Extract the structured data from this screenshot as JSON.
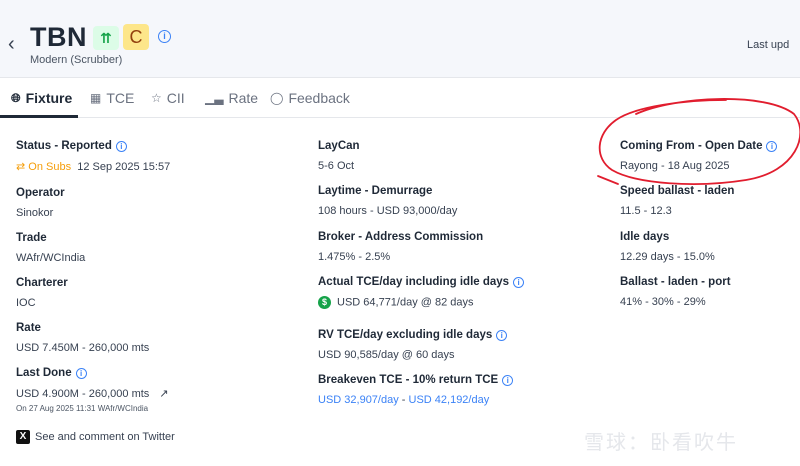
{
  "header": {
    "back_icon": "chevron-left-icon",
    "title": "TBN",
    "grade_badge": "C",
    "subtitle": "Modern (Scrubber)",
    "last_updated": "Last upd"
  },
  "tabs": [
    {
      "label": "Fixture",
      "icon": "globe-icon",
      "active": true
    },
    {
      "label": "TCE",
      "icon": "grid-icon",
      "active": false
    },
    {
      "label": "CII",
      "icon": "star-icon",
      "active": false
    },
    {
      "label": "Rate",
      "icon": "bar-chart-icon",
      "active": false
    },
    {
      "label": "Feedback",
      "icon": "comment-icon",
      "active": false
    }
  ],
  "col1": {
    "status_label": "Status - Reported",
    "status_badge": "On Subs",
    "status_date": "12 Sep 2025 15:57",
    "operator_label": "Operator",
    "operator_value": "Sinokor",
    "trade_label": "Trade",
    "trade_value": "WAfr/WCIndia",
    "charterer_label": "Charterer",
    "charterer_value": "IOC",
    "rate_label": "Rate",
    "rate_value": "USD 7.450M - 260,000 mts",
    "last_done_label": "Last Done",
    "last_done_value": "USD 4.900M - 260,000 mts",
    "last_done_note": "On 27 Aug 2025 11:31 WAfr/WCIndia"
  },
  "col2": {
    "laycan_label": "LayCan",
    "laycan_value": "5-6 Oct",
    "laytime_label": "Laytime - Demurrage",
    "laytime_value": "108 hours - USD 93,000/day",
    "broker_label": "Broker - Address Commission",
    "broker_value": "1.475% - 2.5%",
    "actual_tce_label": "Actual TCE/day including idle days",
    "actual_tce_value": "USD 64,771/day @ 82 days",
    "rv_tce_label": "RV TCE/day excluding idle days",
    "rv_tce_value": "USD 90,585/day @ 60 days",
    "breakeven_label": "Breakeven TCE - 10% return TCE",
    "breakeven_value_1": "USD 32,907/day",
    "breakeven_sep": " - ",
    "breakeven_value_2": "USD 42,192/day"
  },
  "col3": {
    "coming_from_label": "Coming From - Open Date",
    "coming_from_value": "Rayong - 18 Aug 2025",
    "speed_label": "Speed ballast - laden",
    "speed_value": "11.5 - 12.3",
    "idle_label": "Idle days",
    "idle_value": "12.29 days - 15.0%",
    "ballast_label": "Ballast - laden - port",
    "ballast_value": "41% - 30% - 29%"
  },
  "footer": {
    "twitter_text": "See and comment on Twitter"
  },
  "watermark": "雪球：卧看吹牛",
  "colors": {
    "accent": "#3b82f6",
    "orange": "#f59e0b",
    "annotation": "#e11d2e"
  }
}
